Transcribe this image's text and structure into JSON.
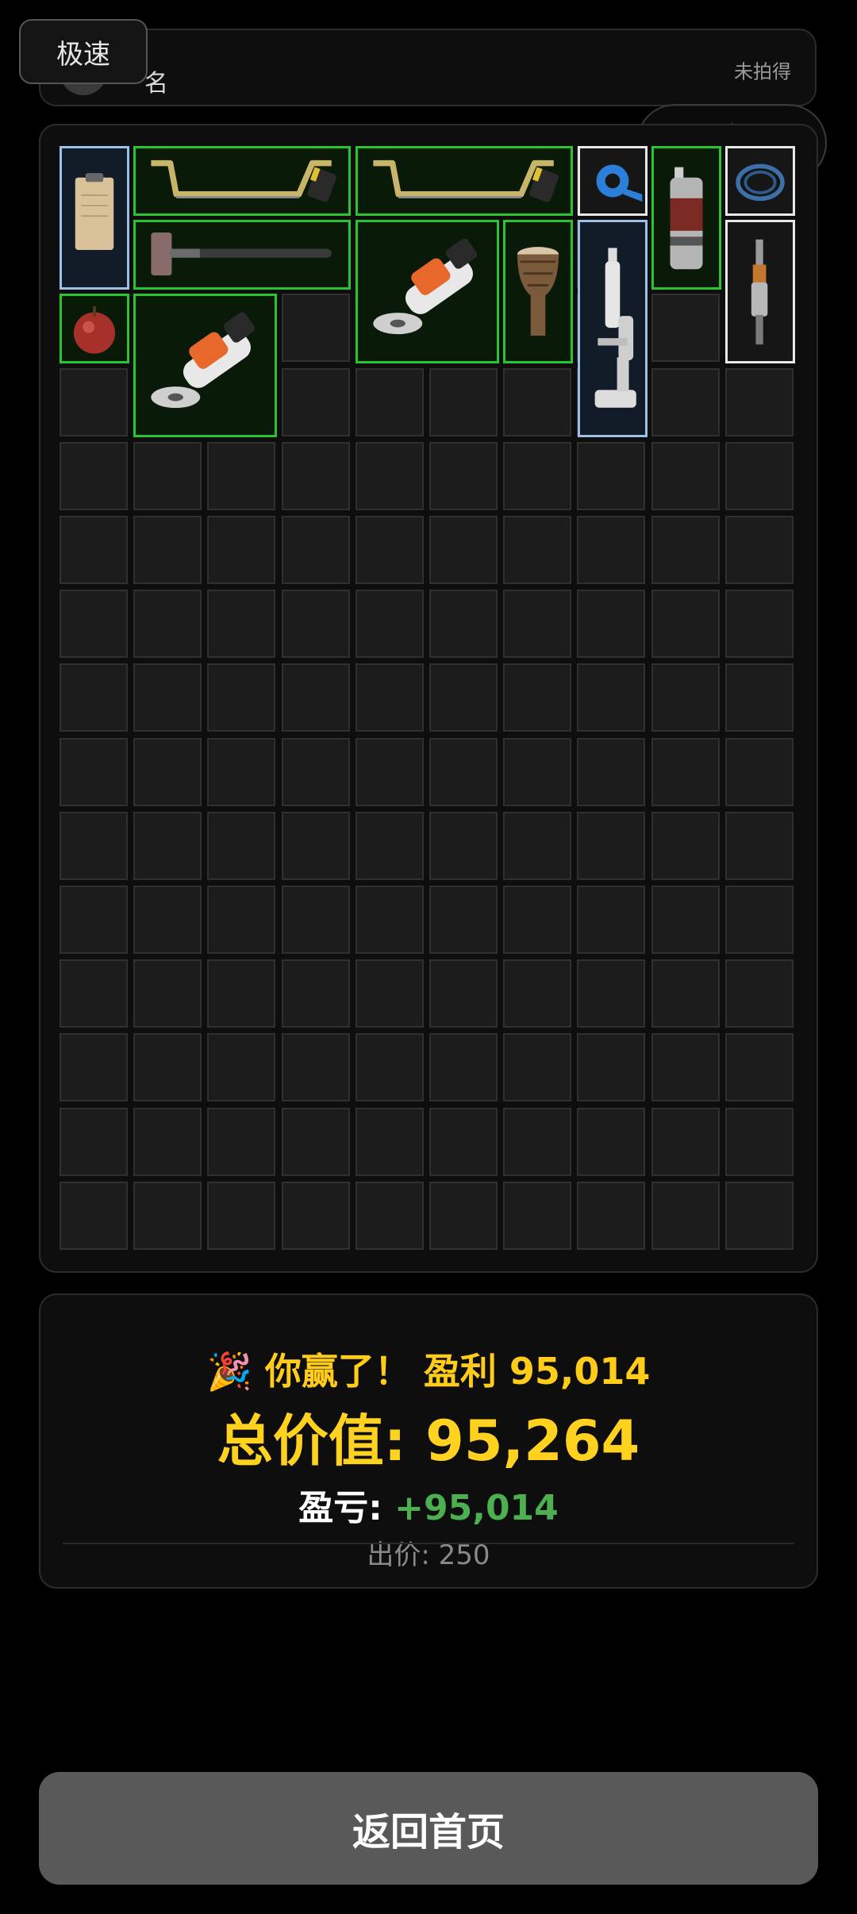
{
  "top_bar": {
    "speed_label": "极速",
    "player_name": "名",
    "auction_status": "未拍得"
  },
  "mini_program_capsule": {
    "more_icon": "more-dots-icon",
    "close_icon": "target-close-icon"
  },
  "inventory": {
    "columns": 10,
    "rows": 15,
    "items": [
      {
        "name": "clipboard",
        "rarity": "blue",
        "icon": "clipboard-icon"
      },
      {
        "name": "hacksaw",
        "rarity": "green",
        "icon": "hacksaw-icon"
      },
      {
        "name": "hacksaw",
        "rarity": "green",
        "icon": "hacksaw-icon"
      },
      {
        "name": "blue tape",
        "rarity": "white",
        "icon": "tape-icon"
      },
      {
        "name": "spray can",
        "rarity": "green",
        "icon": "spray-can-icon"
      },
      {
        "name": "cable",
        "rarity": "white",
        "icon": "cable-icon"
      },
      {
        "name": "sledgehammer",
        "rarity": "green",
        "icon": "sledgehammer-icon"
      },
      {
        "name": "angle grinder",
        "rarity": "green",
        "icon": "angle-grinder-icon"
      },
      {
        "name": "djembe drum",
        "rarity": "green",
        "icon": "drum-icon"
      },
      {
        "name": "microscope",
        "rarity": "blue",
        "icon": "microscope-icon"
      },
      {
        "name": "spark plug",
        "rarity": "white",
        "icon": "spark-plug-icon"
      },
      {
        "name": "apple",
        "rarity": "green",
        "icon": "apple-icon"
      },
      {
        "name": "angle grinder",
        "rarity": "green",
        "icon": "angle-grinder-icon"
      }
    ]
  },
  "result": {
    "party_icon": "🎉",
    "win_text": "你赢了！ 盈利 95,014",
    "total_label": "总价值: ",
    "total_value": "95,264",
    "pl_label": "盈亏: ",
    "pl_value": "+95,014",
    "bid_text": "出价: 250"
  },
  "colors": {
    "green_rarity": "#29c42f",
    "blue_rarity": "#9fc0e6",
    "white_rarity": "#e8e8e8",
    "win_yellow": "#ffcc1a",
    "profit_green": "#4caf50"
  },
  "home_button_label": "返回首页"
}
